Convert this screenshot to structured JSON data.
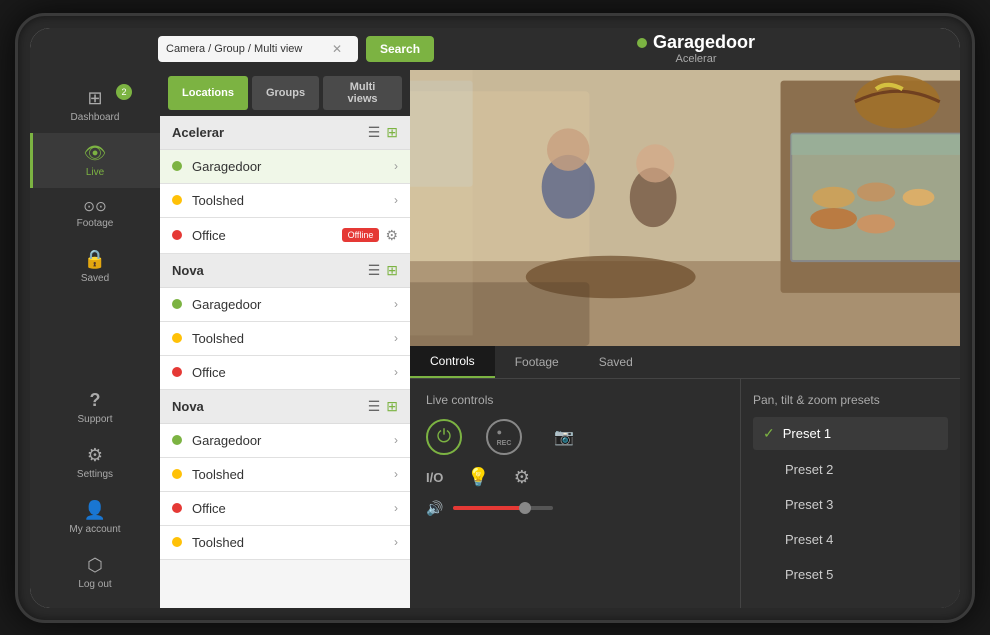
{
  "app": {
    "title": "Garagedoor",
    "subtitle": "Acelerar"
  },
  "topbar": {
    "search_placeholder": "Camera / Group / Multi view",
    "search_value": "Camera / Group / Multi view",
    "search_btn": "Search",
    "camera_dot_color": "#7cb342",
    "camera_name": "Garagedoor",
    "camera_group": "Acelerar"
  },
  "sidebar": {
    "badge_count": "2",
    "items": [
      {
        "id": "dashboard",
        "label": "Dashboard",
        "icon": "⊞",
        "active": false
      },
      {
        "id": "live",
        "label": "Live",
        "icon": "👁",
        "active": true
      },
      {
        "id": "footage",
        "label": "Footage",
        "icon": "⊙⊙",
        "active": false
      },
      {
        "id": "saved",
        "label": "Saved",
        "icon": "🔒",
        "active": false
      },
      {
        "id": "support",
        "label": "Support",
        "icon": "?",
        "active": false
      },
      {
        "id": "settings",
        "label": "Settings",
        "icon": "⚙",
        "active": false
      },
      {
        "id": "myaccount",
        "label": "My account",
        "icon": "👤",
        "active": false
      },
      {
        "id": "logout",
        "label": "Log out",
        "icon": "→",
        "active": false
      }
    ]
  },
  "list_panel": {
    "tabs": [
      {
        "id": "locations",
        "label": "Locations",
        "active": true
      },
      {
        "id": "groups",
        "label": "Groups",
        "active": false
      },
      {
        "id": "multiviews",
        "label": "Multi views",
        "active": false
      }
    ],
    "groups": [
      {
        "name": "Acelerar",
        "cameras": [
          {
            "name": "Garagedoor",
            "status": "green",
            "selected": true,
            "offline": false
          },
          {
            "name": "Toolshed",
            "status": "yellow",
            "selected": false,
            "offline": false
          },
          {
            "name": "Office",
            "status": "red",
            "selected": false,
            "offline": true
          }
        ]
      },
      {
        "name": "Nova",
        "cameras": [
          {
            "name": "Garagedoor",
            "status": "green",
            "selected": false,
            "offline": false
          },
          {
            "name": "Toolshed",
            "status": "yellow",
            "selected": false,
            "offline": false
          },
          {
            "name": "Office",
            "status": "red",
            "selected": false,
            "offline": false
          }
        ]
      },
      {
        "name": "Nova",
        "cameras": [
          {
            "name": "Garagedoor",
            "status": "green",
            "selected": false,
            "offline": false
          },
          {
            "name": "Toolshed",
            "status": "yellow",
            "selected": false,
            "offline": false
          },
          {
            "name": "Office",
            "status": "red",
            "selected": false,
            "offline": false
          },
          {
            "name": "Toolshed",
            "status": "yellow",
            "selected": false,
            "offline": false
          }
        ]
      }
    ]
  },
  "controls": {
    "tabs": [
      {
        "id": "controls",
        "label": "Controls",
        "active": true
      },
      {
        "id": "footage",
        "label": "Footage",
        "active": false
      },
      {
        "id": "saved",
        "label": "Saved",
        "active": false
      }
    ],
    "live_controls_title": "Live controls",
    "ptz_title": "Pan, tilt & zoom presets",
    "presets": [
      {
        "label": "Preset 1",
        "selected": true
      },
      {
        "label": "Preset 2",
        "selected": false
      },
      {
        "label": "Preset 3",
        "selected": false
      },
      {
        "label": "Preset 4",
        "selected": false
      },
      {
        "label": "Preset 5",
        "selected": false
      }
    ],
    "offline_label": "Offline"
  }
}
